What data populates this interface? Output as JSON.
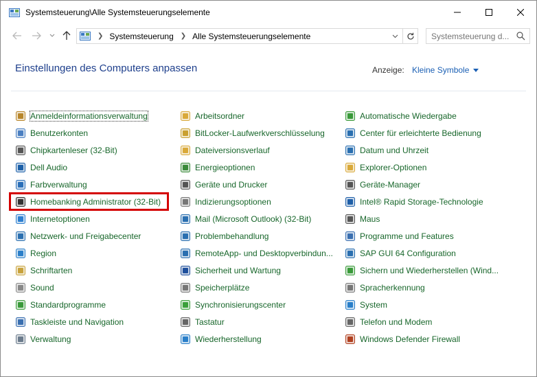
{
  "window": {
    "title": "Systemsteuerung\\Alle Systemsteuerungselemente",
    "controls": {
      "minimize": "–",
      "maximize": "☐",
      "close": "✕"
    }
  },
  "address": {
    "breadcrumbs": [
      "Systemsteuerung",
      "Alle Systemsteuerungselemente"
    ],
    "search_placeholder": "Systemsteuerung d..."
  },
  "header": {
    "title": "Einstellungen des Computers anpassen",
    "view_label": "Anzeige:",
    "view_value": "Kleine Symbole"
  },
  "columns": [
    [
      {
        "label": "Anmeldeinformationsverwaltung",
        "icon": "credential-manager-icon",
        "color": "#b8862b"
      },
      {
        "label": "Benutzerkonten",
        "icon": "user-accounts-icon",
        "color": "#4a7fc1"
      },
      {
        "label": "Chipkartenleser (32-Bit)",
        "icon": "smartcard-reader-icon",
        "color": "#555555"
      },
      {
        "label": "Dell Audio",
        "icon": "dell-audio-icon",
        "color": "#1b5fa8"
      },
      {
        "label": "Farbverwaltung",
        "icon": "color-management-icon",
        "color": "#2b6fb8"
      },
      {
        "label": "Homebanking Administrator (32-Bit)",
        "icon": "homebanking-icon",
        "color": "#333333"
      },
      {
        "label": "Internetoptionen",
        "icon": "internet-options-icon",
        "color": "#2d7fd0"
      },
      {
        "label": "Netzwerk- und Freigabecenter",
        "icon": "network-center-icon",
        "color": "#2a6fb0"
      },
      {
        "label": "Region",
        "icon": "region-icon",
        "color": "#2b7fc9"
      },
      {
        "label": "Schriftarten",
        "icon": "fonts-icon",
        "color": "#c8a23c"
      },
      {
        "label": "Sound",
        "icon": "sound-icon",
        "color": "#888888"
      },
      {
        "label": "Standardprogramme",
        "icon": "default-programs-icon",
        "color": "#3a9a3a"
      },
      {
        "label": "Taskleiste und Navigation",
        "icon": "taskbar-icon",
        "color": "#3a6fb0"
      },
      {
        "label": "Verwaltung",
        "icon": "administration-icon",
        "color": "#6b7b8c"
      }
    ],
    [
      {
        "label": "Arbeitsordner",
        "icon": "work-folders-icon",
        "color": "#d9a93a"
      },
      {
        "label": "BitLocker-Laufwerkverschlüsselung",
        "icon": "bitlocker-icon",
        "color": "#c9a030"
      },
      {
        "label": "Dateiversionsverlauf",
        "icon": "file-history-icon",
        "color": "#d9a93a"
      },
      {
        "label": "Energieoptionen",
        "icon": "power-options-icon",
        "color": "#3a8a3a"
      },
      {
        "label": "Geräte und Drucker",
        "icon": "devices-printers-icon",
        "color": "#555555"
      },
      {
        "label": "Indizierungsoptionen",
        "icon": "indexing-icon",
        "color": "#777777"
      },
      {
        "label": "Mail (Microsoft Outlook) (32-Bit)",
        "icon": "mail-icon",
        "color": "#2a6fb0"
      },
      {
        "label": "Problembehandlung",
        "icon": "troubleshooting-icon",
        "color": "#2a6fb0"
      },
      {
        "label": "RemoteApp- und Desktopverbindun...",
        "icon": "remoteapp-icon",
        "color": "#2a6fb0"
      },
      {
        "label": "Sicherheit und Wartung",
        "icon": "security-maintenance-icon",
        "color": "#1e4f9c"
      },
      {
        "label": "Speicherplätze",
        "icon": "storage-spaces-icon",
        "color": "#777777"
      },
      {
        "label": "Synchronisierungscenter",
        "icon": "sync-center-icon",
        "color": "#3aa03a"
      },
      {
        "label": "Tastatur",
        "icon": "keyboard-icon",
        "color": "#666666"
      },
      {
        "label": "Wiederherstellung",
        "icon": "recovery-icon",
        "color": "#2a7fc9"
      }
    ],
    [
      {
        "label": "Automatische Wiedergabe",
        "icon": "autoplay-icon",
        "color": "#3a9a3a"
      },
      {
        "label": "Center für erleichterte Bedienung",
        "icon": "ease-of-access-icon",
        "color": "#2a6fb0"
      },
      {
        "label": "Datum und Uhrzeit",
        "icon": "date-time-icon",
        "color": "#2a6fb0"
      },
      {
        "label": "Explorer-Optionen",
        "icon": "explorer-options-icon",
        "color": "#d9a93a"
      },
      {
        "label": "Geräte-Manager",
        "icon": "device-manager-icon",
        "color": "#555555"
      },
      {
        "label": "Intel® Rapid Storage-Technologie",
        "icon": "intel-rst-icon",
        "color": "#1f5fa8"
      },
      {
        "label": "Maus",
        "icon": "mouse-icon",
        "color": "#555555"
      },
      {
        "label": "Programme und Features",
        "icon": "programs-features-icon",
        "color": "#3a6fb0"
      },
      {
        "label": "SAP GUI 64 Configuration",
        "icon": "sap-gui-icon",
        "color": "#2a6fb0"
      },
      {
        "label": "Sichern und Wiederherstellen (Wind...",
        "icon": "backup-restore-icon",
        "color": "#3a9a3a"
      },
      {
        "label": "Spracherkennung",
        "icon": "speech-recognition-icon",
        "color": "#777777"
      },
      {
        "label": "System",
        "icon": "system-icon",
        "color": "#2a7fc9"
      },
      {
        "label": "Telefon und Modem",
        "icon": "phone-modem-icon",
        "color": "#666666"
      },
      {
        "label": "Windows Defender Firewall",
        "icon": "firewall-icon",
        "color": "#b04020"
      }
    ]
  ]
}
